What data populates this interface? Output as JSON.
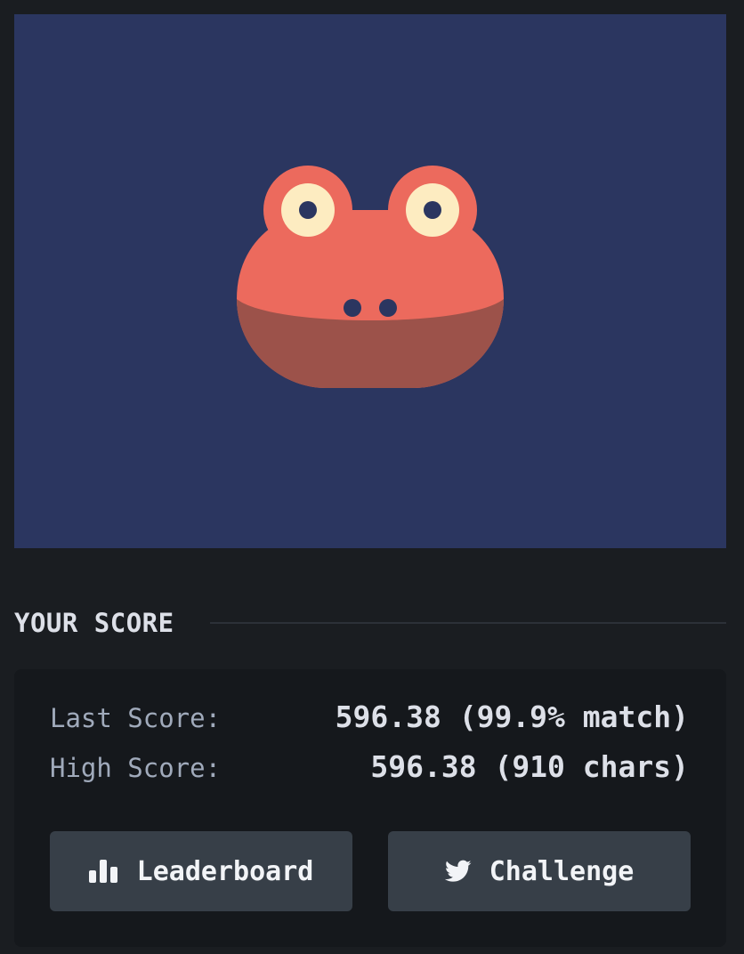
{
  "canvas": {
    "subject": "frog-face",
    "colors": {
      "background": "#2b3660",
      "head": "#ec6a5d",
      "jaw": "#9c524a",
      "eye_white": "#fdecc1",
      "pupil": "#2b3660",
      "nostril": "#2b3660"
    }
  },
  "score_section": {
    "title": "YOUR SCORE"
  },
  "scores": {
    "last_label": "Last Score:",
    "last_value": "596.38 (99.9% match)",
    "high_label": "High Score:",
    "high_value": "596.38 (910 chars)"
  },
  "buttons": {
    "leaderboard_label": "Leaderboard",
    "leaderboard_icon": "bar-chart-icon",
    "challenge_label": "Challenge",
    "challenge_icon": "twitter-bird-icon"
  }
}
